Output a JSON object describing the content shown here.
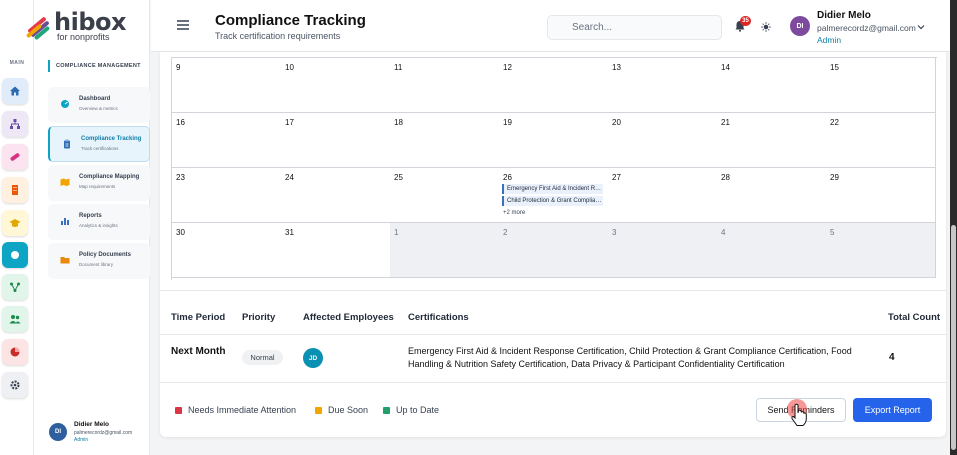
{
  "brand": {
    "name": "hibox",
    "tagline": "for nonprofits"
  },
  "rail": {
    "label": "MAIN",
    "items": [
      {
        "icon": "home-icon",
        "color": "#2b6cb0",
        "bg": "#e0ecfa"
      },
      {
        "icon": "hierarchy-icon",
        "color": "#6b4ba5",
        "bg": "#ede7f6"
      },
      {
        "icon": "pill-icon",
        "color": "#d63384",
        "bg": "#fbe4ef"
      },
      {
        "icon": "building-icon",
        "color": "#e8590c",
        "bg": "#fff0e0"
      },
      {
        "icon": "graduation-cap-icon",
        "color": "#e0a800",
        "bg": "#fff7d6"
      },
      {
        "icon": "circle-icon",
        "color": "#ffffff",
        "bg": "#0ea5c5"
      },
      {
        "icon": "network-icon",
        "color": "#1b8a4a",
        "bg": "#e2f5ea"
      },
      {
        "icon": "users-icon",
        "color": "#1b8a4a",
        "bg": "#e2f5ea"
      },
      {
        "icon": "pie-chart-icon",
        "color": "#c92a2a",
        "bg": "#fde4e4"
      },
      {
        "icon": "gear-icon",
        "color": "#374151",
        "bg": "#eef0f3"
      }
    ]
  },
  "sidebar": {
    "section": "COMPLIANCE MANAGEMENT",
    "items": [
      {
        "title": "Dashboard",
        "sub": "Overview & metrics",
        "icon": "dashboard-icon"
      },
      {
        "title": "Compliance Tracking",
        "sub": "Track certifications",
        "icon": "clipboard-icon"
      },
      {
        "title": "Compliance Mapping",
        "sub": "Map requirements",
        "icon": "map-icon"
      },
      {
        "title": "Reports",
        "sub": "Analytics & insights",
        "icon": "bar-chart-icon"
      },
      {
        "title": "Policy Documents",
        "sub": "Document library",
        "icon": "folder-icon"
      }
    ],
    "user": {
      "initials": "DI",
      "name": "Didier Melo",
      "email": "palmerecordz@gmail.com",
      "role": "Admin"
    }
  },
  "header": {
    "title": "Compliance Tracking",
    "subtitle": "Track certification requirements",
    "search_placeholder": "Search...",
    "notification_count": "35",
    "user": {
      "initials": "DI",
      "name": "Didier Melo",
      "email": "palmerecordz@gmail.com",
      "role": "Admin"
    }
  },
  "calendar": {
    "weeks": [
      [
        {
          "day": "9"
        },
        {
          "day": "10"
        },
        {
          "day": "11"
        },
        {
          "day": "12"
        },
        {
          "day": "13"
        },
        {
          "day": "14"
        },
        {
          "day": "15"
        }
      ],
      [
        {
          "day": "16"
        },
        {
          "day": "17"
        },
        {
          "day": "18"
        },
        {
          "day": "19"
        },
        {
          "day": "20"
        },
        {
          "day": "21"
        },
        {
          "day": "22"
        }
      ],
      [
        {
          "day": "23"
        },
        {
          "day": "24"
        },
        {
          "day": "25"
        },
        {
          "day": "26",
          "events": [
            "Emergency First Aid & Incident Response Certification",
            "Child Protection & Grant Compliance Certification"
          ],
          "more": "+2 more"
        },
        {
          "day": "27"
        },
        {
          "day": "28"
        },
        {
          "day": "29"
        }
      ],
      [
        {
          "day": "30"
        },
        {
          "day": "31"
        },
        {
          "day": "1",
          "other": true
        },
        {
          "day": "2",
          "other": true
        },
        {
          "day": "3",
          "other": true
        },
        {
          "day": "4",
          "other": true
        },
        {
          "day": "5",
          "other": true
        }
      ]
    ]
  },
  "table": {
    "headers": {
      "period": "Time Period",
      "priority": "Priority",
      "employees": "Affected Employees",
      "certifications": "Certifications",
      "total": "Total Count"
    },
    "row": {
      "period": "Next Month",
      "priority": "Normal",
      "employee_initials": "JD",
      "certifications": "Emergency First Aid & Incident Response Certification, Child Protection & Grant Compliance Certification, Food Handling & Nutrition Safety Certification, Data Privacy & Participant Confidentiality Certification",
      "total": "4"
    }
  },
  "legend": [
    {
      "label": "Needs Immediate Attention",
      "color": "#dc3545"
    },
    {
      "label": "Due Soon",
      "color": "#f0a500"
    },
    {
      "label": "Up to Date",
      "color": "#22a06b"
    }
  ],
  "actions": {
    "send_reminders": "Send Reminders",
    "export_report": "Export Report"
  }
}
